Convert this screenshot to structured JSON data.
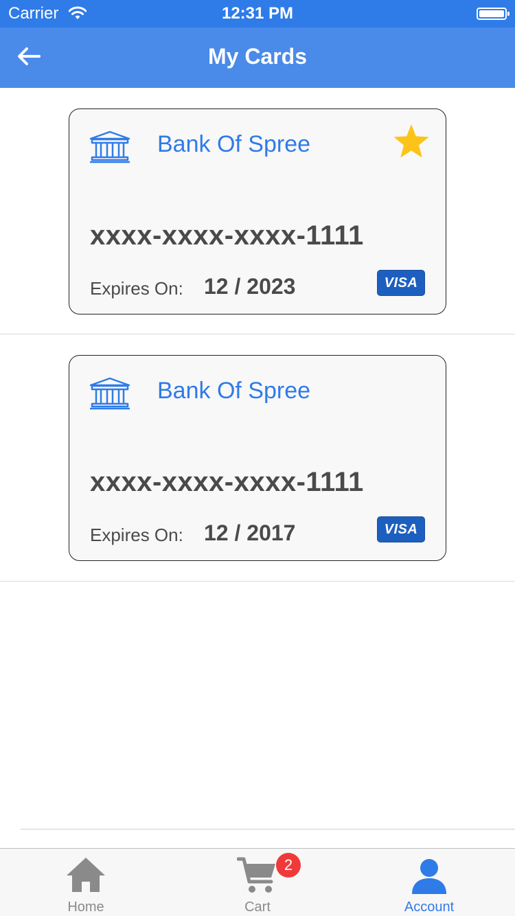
{
  "status_bar": {
    "carrier": "Carrier",
    "time": "12:31 PM",
    "wifi_icon": "wifi-icon",
    "battery_icon": "battery-icon"
  },
  "nav": {
    "title": "My Cards",
    "back_icon": "arrow-left-icon"
  },
  "cards": [
    {
      "bank_name": "Bank Of Spree",
      "number": "xxxx-xxxx-xxxx-1111",
      "expires_label": "Expires On:",
      "expiry": "12 / 2023",
      "brand": "VISA",
      "is_default": true
    },
    {
      "bank_name": "Bank Of Spree",
      "number": "xxxx-xxxx-xxxx-1111",
      "expires_label": "Expires On:",
      "expiry": "12 / 2017",
      "brand": "VISA",
      "is_default": false
    }
  ],
  "tab_bar": {
    "home_label": "Home",
    "cart_label": "Cart",
    "cart_count": "2",
    "account_label": "Account",
    "active_tab": "Account"
  },
  "colors": {
    "primary": "#2f7be8",
    "nav_bar": "#4a8ae9",
    "star": "#fcc419",
    "visa": "#1d5fbf",
    "badge": "#f03a3a",
    "inactive": "#8a8a8a"
  }
}
